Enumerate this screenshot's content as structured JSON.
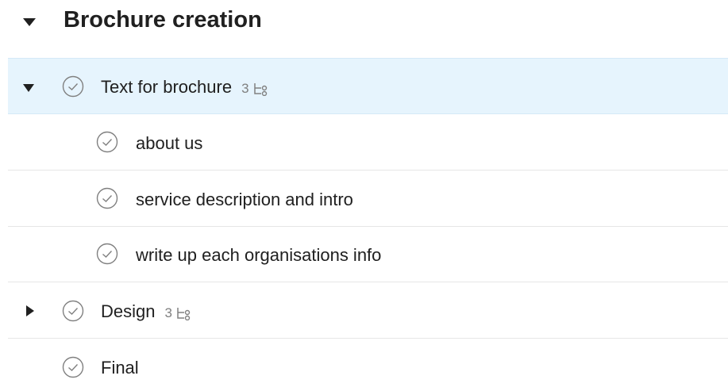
{
  "section": {
    "title": "Brochure creation",
    "expanded": true
  },
  "tasks": [
    {
      "label": "Text for brochure",
      "subtask_count": "3",
      "expanded": true,
      "selected": true,
      "level": 0
    },
    {
      "label": "about us",
      "level": 1
    },
    {
      "label": "service description and intro",
      "level": 1
    },
    {
      "label": "write up each organisations info",
      "level": 1
    },
    {
      "label": "Design",
      "subtask_count": "3",
      "expanded": false,
      "level": 0
    },
    {
      "label": "Final",
      "level": 0
    }
  ],
  "icons": {
    "expand": "triangle-down-icon",
    "collapse": "triangle-right-icon",
    "complete": "check-circle-icon",
    "subtasks": "subtasks-icon"
  },
  "colors": {
    "selected_background": "#e6f4fd",
    "divider": "#e6e6e6",
    "icon_gray": "#808080",
    "text": "#202020"
  }
}
